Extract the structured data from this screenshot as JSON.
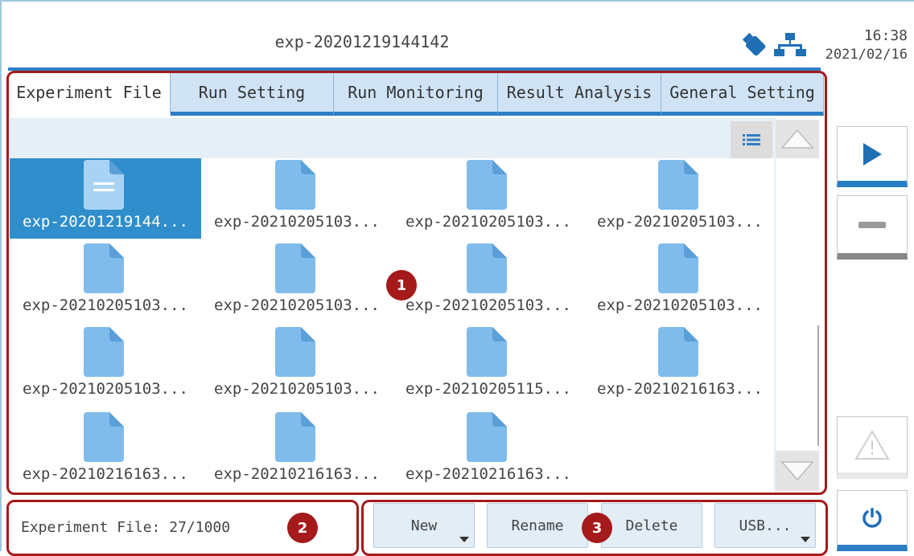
{
  "header": {
    "title": "exp-20201219144142",
    "time": "16:38",
    "date": "2021/02/16",
    "icons": [
      "usb-drive-icon",
      "network-icon"
    ]
  },
  "tabs": [
    {
      "label": "Experiment File",
      "active": true
    },
    {
      "label": "Run Setting",
      "active": false
    },
    {
      "label": "Run Monitoring",
      "active": false
    },
    {
      "label": "Result Analysis",
      "active": false
    },
    {
      "label": "General Setting",
      "active": false
    }
  ],
  "files": [
    {
      "name": "exp-20201219144...",
      "selected": true
    },
    {
      "name": "exp-20210205103...",
      "selected": false
    },
    {
      "name": "exp-20210205103...",
      "selected": false
    },
    {
      "name": "exp-20210205103...",
      "selected": false
    },
    {
      "name": "exp-20210205103...",
      "selected": false
    },
    {
      "name": "exp-20210205103...",
      "selected": false
    },
    {
      "name": "exp-20210205103...",
      "selected": false
    },
    {
      "name": "exp-20210205103...",
      "selected": false
    },
    {
      "name": "exp-20210205103...",
      "selected": false
    },
    {
      "name": "exp-20210205103...",
      "selected": false
    },
    {
      "name": "exp-20210205115...",
      "selected": false
    },
    {
      "name": "exp-20210216163...",
      "selected": false
    },
    {
      "name": "exp-20210216163...",
      "selected": false
    },
    {
      "name": "exp-20210216163...",
      "selected": false
    },
    {
      "name": "exp-20210216163...",
      "selected": false
    }
  ],
  "status": {
    "text": "Experiment File: 27/1000"
  },
  "actions": {
    "new_label": "New",
    "rename_label": "Rename",
    "delete_label": "Delete",
    "usb_label": "USB..."
  },
  "markers": {
    "m1": "1",
    "m2": "2",
    "m3": "3"
  },
  "colors": {
    "accent": "#2b7ec5",
    "tab_background": "#cfe3f5",
    "selected_file": "#2f8ecb",
    "file_icon": "#7fbcec",
    "callout": "#a51a1a"
  }
}
